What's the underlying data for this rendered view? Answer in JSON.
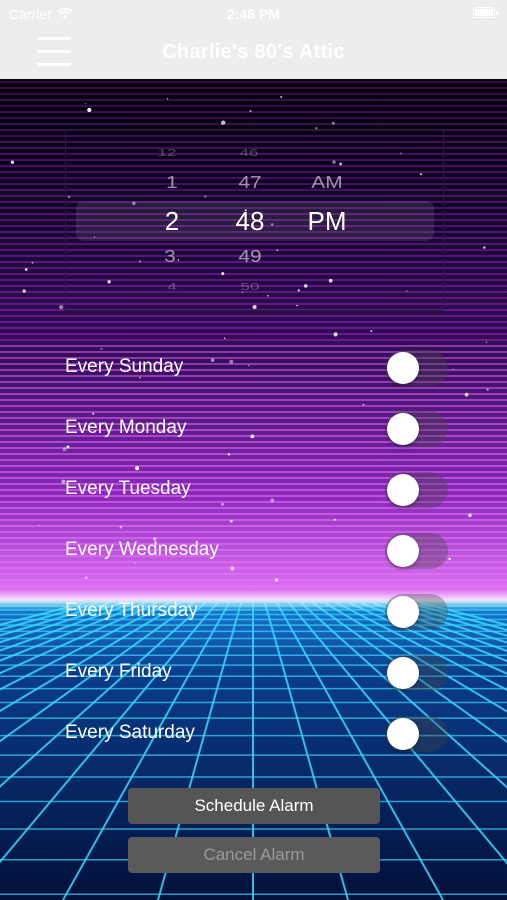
{
  "status_bar": {
    "carrier": "Carrier",
    "time": "2:48 PM"
  },
  "nav": {
    "title": "Charlie's 80's Attic",
    "menu_icon": "hamburger-menu-icon"
  },
  "time_picker": {
    "hours": [
      "12",
      "1",
      "2",
      "3",
      "4"
    ],
    "minutes": [
      "46",
      "47",
      "48",
      "49",
      "50"
    ],
    "periods": [
      "AM",
      "PM"
    ],
    "selected": {
      "hour": "2",
      "minute": "48",
      "period": "PM"
    }
  },
  "days": [
    {
      "label": "Every Sunday",
      "enabled": false
    },
    {
      "label": "Every Monday",
      "enabled": false
    },
    {
      "label": "Every Tuesday",
      "enabled": false
    },
    {
      "label": "Every Wednesday",
      "enabled": false
    },
    {
      "label": "Every Thursday",
      "enabled": false
    },
    {
      "label": "Every Friday",
      "enabled": false
    },
    {
      "label": "Every Saturday",
      "enabled": false
    }
  ],
  "buttons": {
    "schedule": "Schedule Alarm",
    "cancel": "Cancel Alarm"
  },
  "colors": {
    "sky_top": "#05020d",
    "sky_mid": "#5a1a8c",
    "horizon_glow": "#e880ff",
    "grid_blue": "#1f7bff",
    "grid_cyan": "#3ff0ff"
  }
}
